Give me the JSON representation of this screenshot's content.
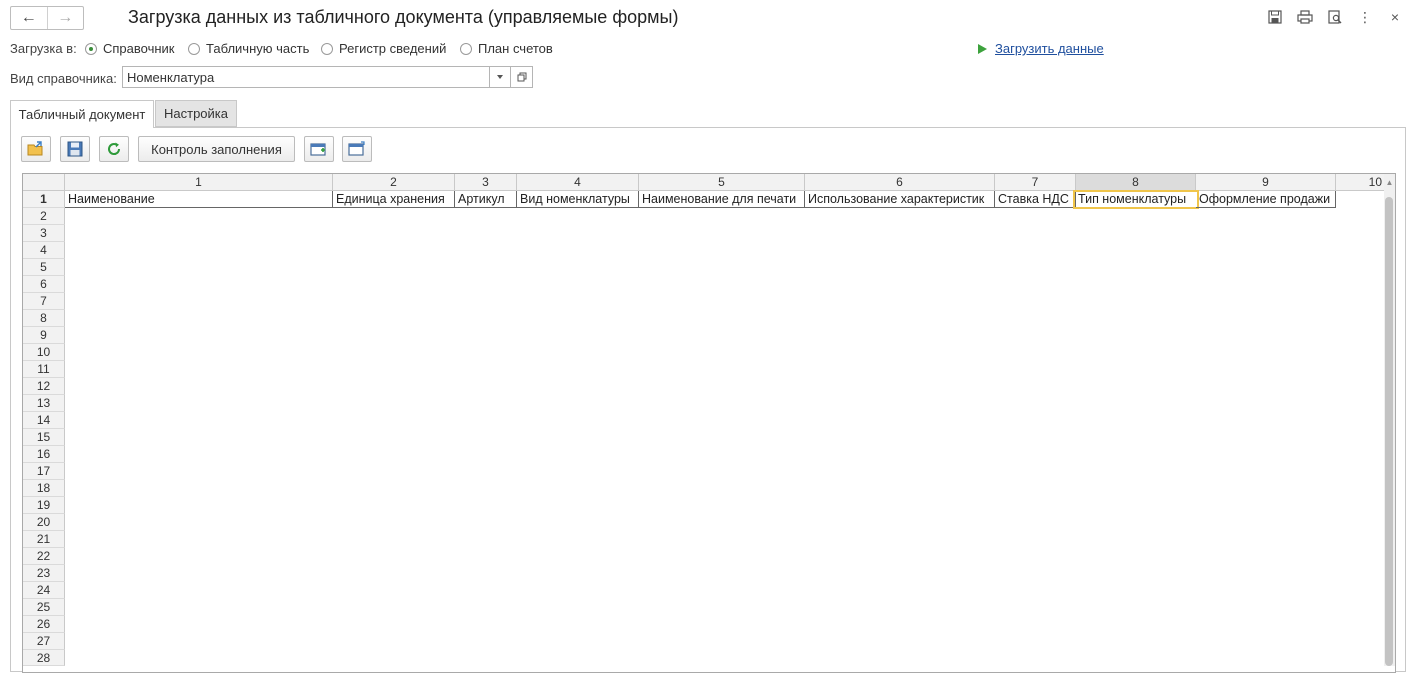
{
  "window": {
    "title": "Загрузка данных из табличного документа (управляемые формы)",
    "nav_back": "←",
    "nav_forward": "→",
    "icons": [
      "save-icon",
      "print-icon",
      "preview-icon",
      "more-icon",
      "close-icon"
    ],
    "close_glyph": "×",
    "more_glyph": "⋮"
  },
  "load_to": {
    "label": "Загрузка в:",
    "options": [
      {
        "label": "Справочник",
        "checked": true
      },
      {
        "label": "Табличную часть",
        "checked": false
      },
      {
        "label": "Регистр сведений",
        "checked": false
      },
      {
        "label": "План счетов",
        "checked": false
      }
    ],
    "load_link": "Загрузить данные"
  },
  "catalog_kind": {
    "label": "Вид справочника:",
    "value": "Номенклатура"
  },
  "tabs": [
    {
      "label": "Табличный документ",
      "active": true
    },
    {
      "label": "Настройка",
      "active": false
    }
  ],
  "toolbar": {
    "check_fill_label": "Контроль заполнения"
  },
  "sheet": {
    "column_numbers": [
      "1",
      "2",
      "3",
      "4",
      "5",
      "6",
      "7",
      "8",
      "9",
      "10"
    ],
    "selected_column": "8",
    "header_cells": [
      "Наименование",
      "Единица хранения",
      "Артикул",
      "Вид номенклатуры",
      "Наименование для печати",
      "Использование характеристик",
      "Ставка НДС",
      "Тип номенклатуры",
      "Оформление продажи"
    ],
    "row_numbers": [
      "1",
      "2",
      "3",
      "4",
      "5",
      "6",
      "7",
      "8",
      "9",
      "10",
      "11",
      "12",
      "13",
      "14",
      "15",
      "16",
      "17",
      "18",
      "19",
      "20",
      "21",
      "22",
      "23",
      "24",
      "25",
      "26",
      "27",
      "28"
    ]
  },
  "colors": {
    "accent_green": "#3da23d",
    "link_blue": "#1f4f9e",
    "selection_yellow": "#f0c54a"
  }
}
